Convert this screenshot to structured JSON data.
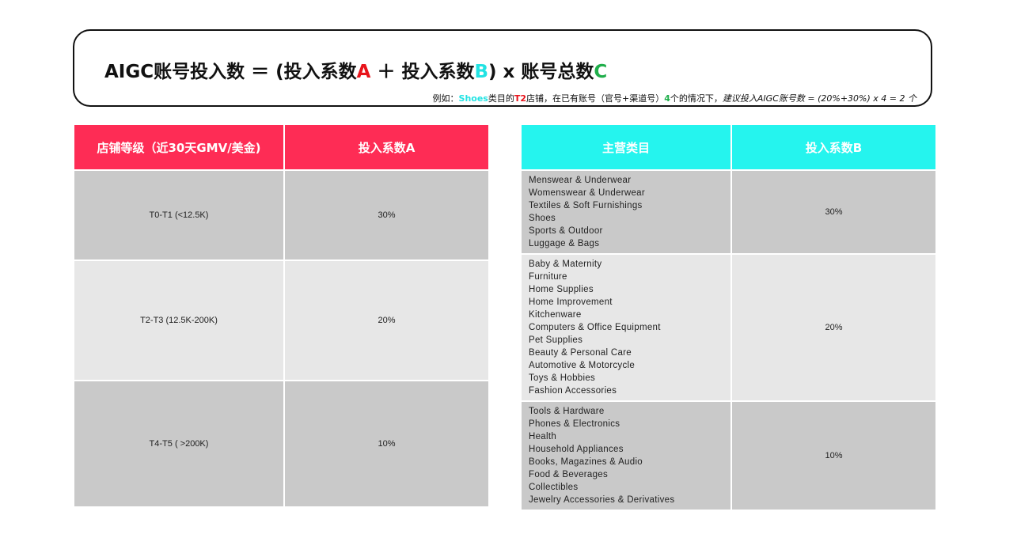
{
  "formula": {
    "part1": "AIGC账号投入数 ＝ (投入系数",
    "a": "A",
    "part2": " ＋ 投入系数",
    "b": "B",
    "part3": ") x 账号总数",
    "c": "C"
  },
  "example": {
    "prefix": "例如：",
    "shoes": "Shoes",
    "mid1": "类目的",
    "t2": "T2",
    "mid2": "店铺，在已有账号（官号+渠道号）",
    "four": "4",
    "mid3": "个的情况下，",
    "italic": "建议投入AIGC账号数 =   (20%+30%) x 4 = 2 个"
  },
  "colors": {
    "pink": "#fe2c55",
    "cyan": "#25f4ee",
    "red": "#e8141b",
    "green": "#1fae4a"
  },
  "table_a": {
    "headers": [
      "店铺等级（近30天GMV/美金)",
      "投入系数A"
    ],
    "rows": [
      {
        "tier": "T0-T1 (<12.5K)",
        "coef": "30%"
      },
      {
        "tier": "T2-T3 (12.5K-200K)",
        "coef": "20%"
      },
      {
        "tier": "T4-T5 ( >200K)",
        "coef": "10%"
      }
    ]
  },
  "table_b": {
    "headers": [
      "主营类目",
      "投入系数B"
    ],
    "rows": [
      {
        "categories": [
          "Menswear & Underwear",
          "Womenswear & Underwear",
          "Textiles & Soft Furnishings",
          "Shoes",
          "Sports & Outdoor",
          "Luggage & Bags"
        ],
        "coef": "30%"
      },
      {
        "categories": [
          "Baby & Maternity",
          "Furniture",
          "Home Supplies",
          "Home Improvement",
          "Kitchenware",
          "Computers & Office Equipment",
          "Pet Supplies",
          "Beauty & Personal Care",
          "Automotive & Motorcycle",
          "Toys & Hobbies",
          "Fashion Accessories"
        ],
        "coef": "20%"
      },
      {
        "categories": [
          "Tools & Hardware",
          "Phones & Electronics",
          "Health",
          "Household Appliances",
          "Books, Magazines & Audio",
          "Food & Beverages",
          "Collectibles",
          "Jewelry Accessories & Derivatives"
        ],
        "coef": "10%"
      }
    ]
  }
}
